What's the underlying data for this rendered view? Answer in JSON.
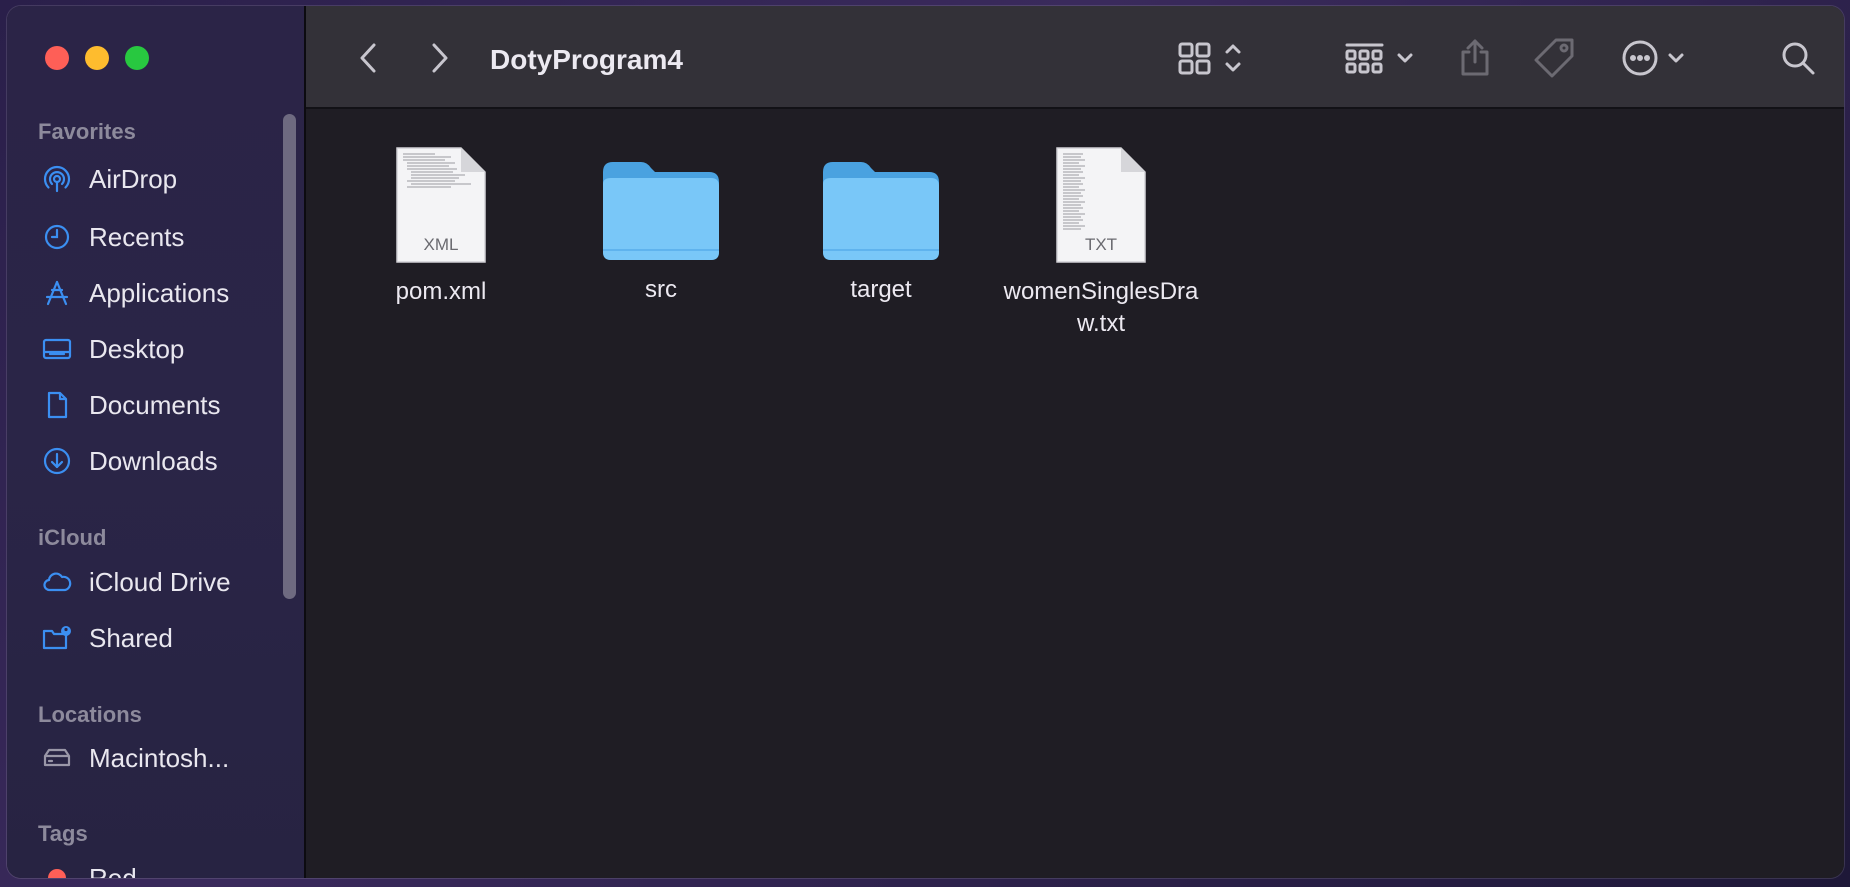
{
  "window": {
    "title": "DotyProgram4"
  },
  "sidebar": {
    "favorites_label": "Favorites",
    "favorites": [
      {
        "label": "AirDrop",
        "icon": "airdrop-icon"
      },
      {
        "label": "Recents",
        "icon": "clock-icon"
      },
      {
        "label": "Applications",
        "icon": "applications-icon"
      },
      {
        "label": "Desktop",
        "icon": "desktop-icon"
      },
      {
        "label": "Documents",
        "icon": "document-icon"
      },
      {
        "label": "Downloads",
        "icon": "download-icon"
      }
    ],
    "icloud_label": "iCloud",
    "icloud": [
      {
        "label": "iCloud Drive",
        "icon": "cloud-icon"
      },
      {
        "label": "Shared",
        "icon": "shared-folder-icon"
      }
    ],
    "locations_label": "Locations",
    "locations": [
      {
        "label": "Macintosh...",
        "icon": "disk-icon"
      }
    ],
    "tags_label": "Tags",
    "tags": [
      {
        "label": "Red",
        "color": "#fe5f57"
      }
    ]
  },
  "files": [
    {
      "name": "pom.xml",
      "kind": "XML"
    },
    {
      "name": "src",
      "kind": "folder"
    },
    {
      "name": "target",
      "kind": "folder"
    },
    {
      "name": "womenSinglesDraw.txt",
      "name_line1": "womenSinglesDra",
      "name_line2": "w.txt",
      "kind": "TXT"
    }
  ],
  "colors": {
    "accent": "#3a8cf0",
    "folder": "#6fc3f7",
    "sidebar_icon": "#3b8ff2"
  }
}
